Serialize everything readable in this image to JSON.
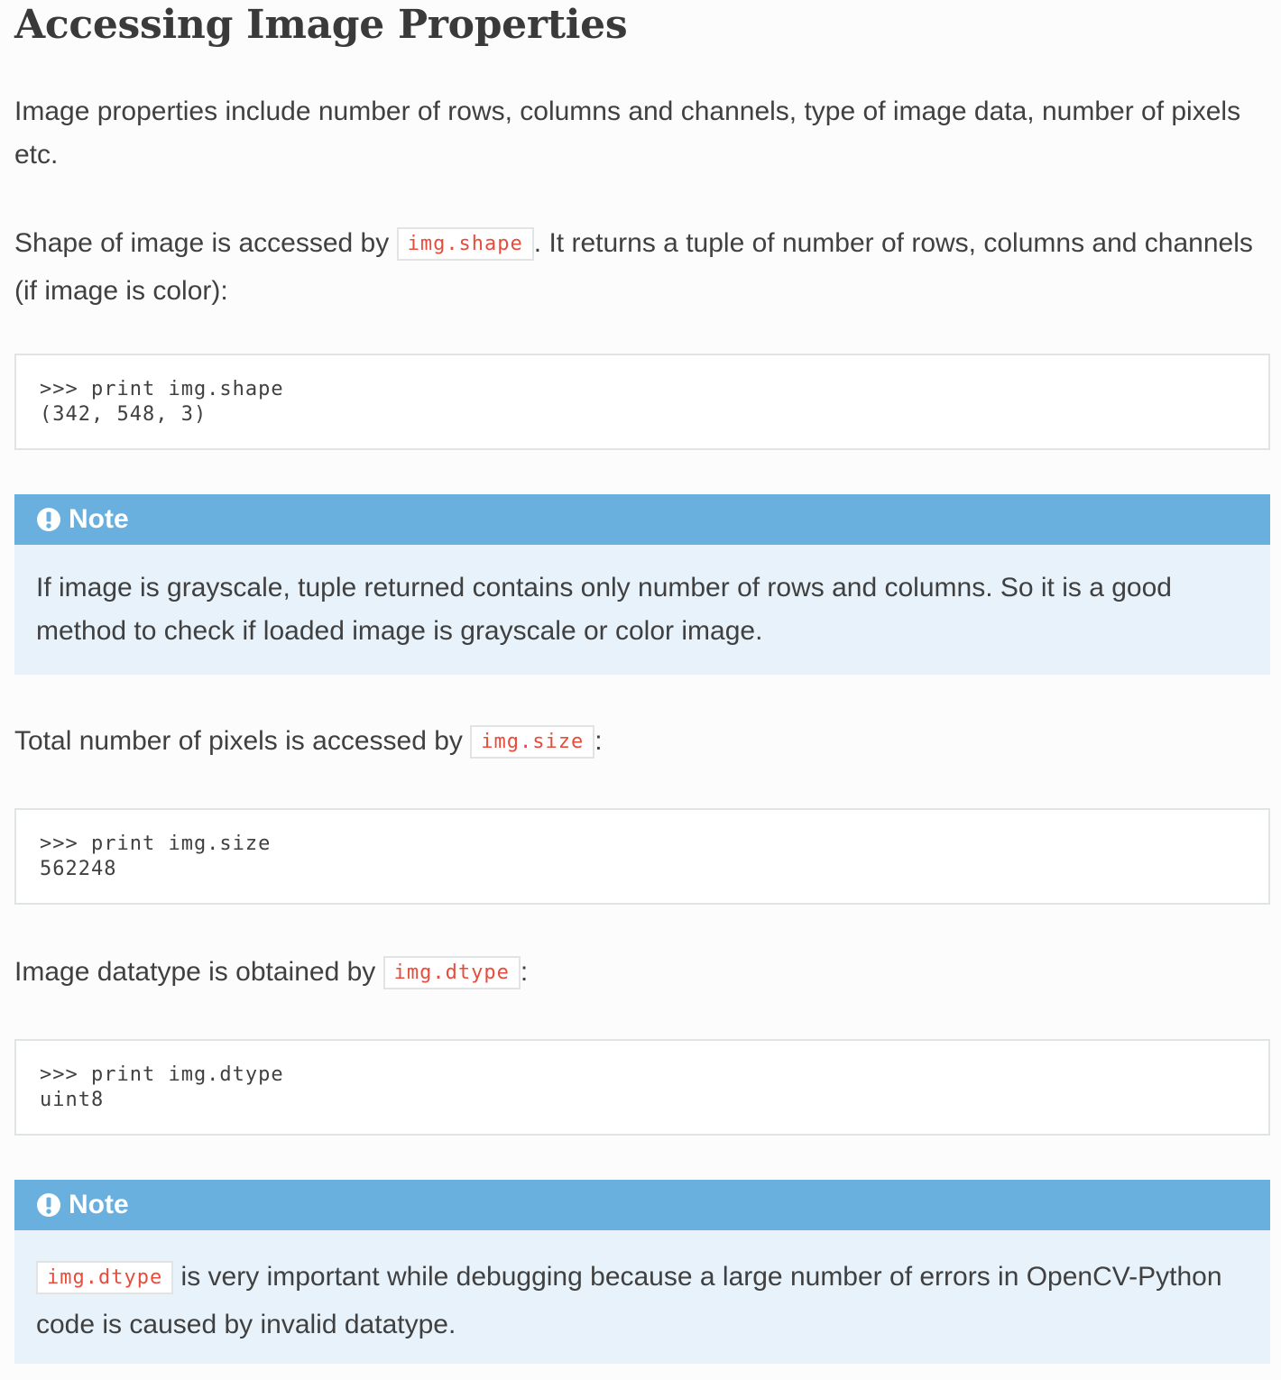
{
  "heading": "Accessing Image Properties",
  "intro": "Image properties include number of rows, columns and channels, type of image data, number of pixels etc.",
  "shape_para": {
    "before": "Shape of image is accessed by ",
    "code": "img.shape",
    "after": ". It returns a tuple of number of rows, columns and channels (if image is color):"
  },
  "code_shape": {
    "line1": ">>> print img.shape",
    "line2": "(342, 548, 3)"
  },
  "note1": {
    "title": "Note",
    "body": "If image is grayscale, tuple returned contains only number of rows and columns. So it is a good method to check if loaded image is grayscale or color image."
  },
  "size_para": {
    "before": "Total number of pixels is accessed by ",
    "code": "img.size",
    "after": ":"
  },
  "code_size": {
    "line1": ">>> print img.size",
    "line2": "562248"
  },
  "dtype_para": {
    "before": "Image datatype is obtained by ",
    "code": "img.dtype",
    "after": ":"
  },
  "code_dtype": {
    "line1": ">>> print img.dtype",
    "line2": "uint8"
  },
  "note2": {
    "title": "Note",
    "code": "img.dtype",
    "body": " is very important while debugging because a large number of errors in OpenCV-Python code is caused by invalid datatype."
  },
  "icons": {
    "note": "exclamation-circle-icon"
  },
  "colors": {
    "note_header": "#6ab0de",
    "note_body": "#e7f2fa",
    "inline_code": "#e74c3c",
    "text": "#404040"
  }
}
